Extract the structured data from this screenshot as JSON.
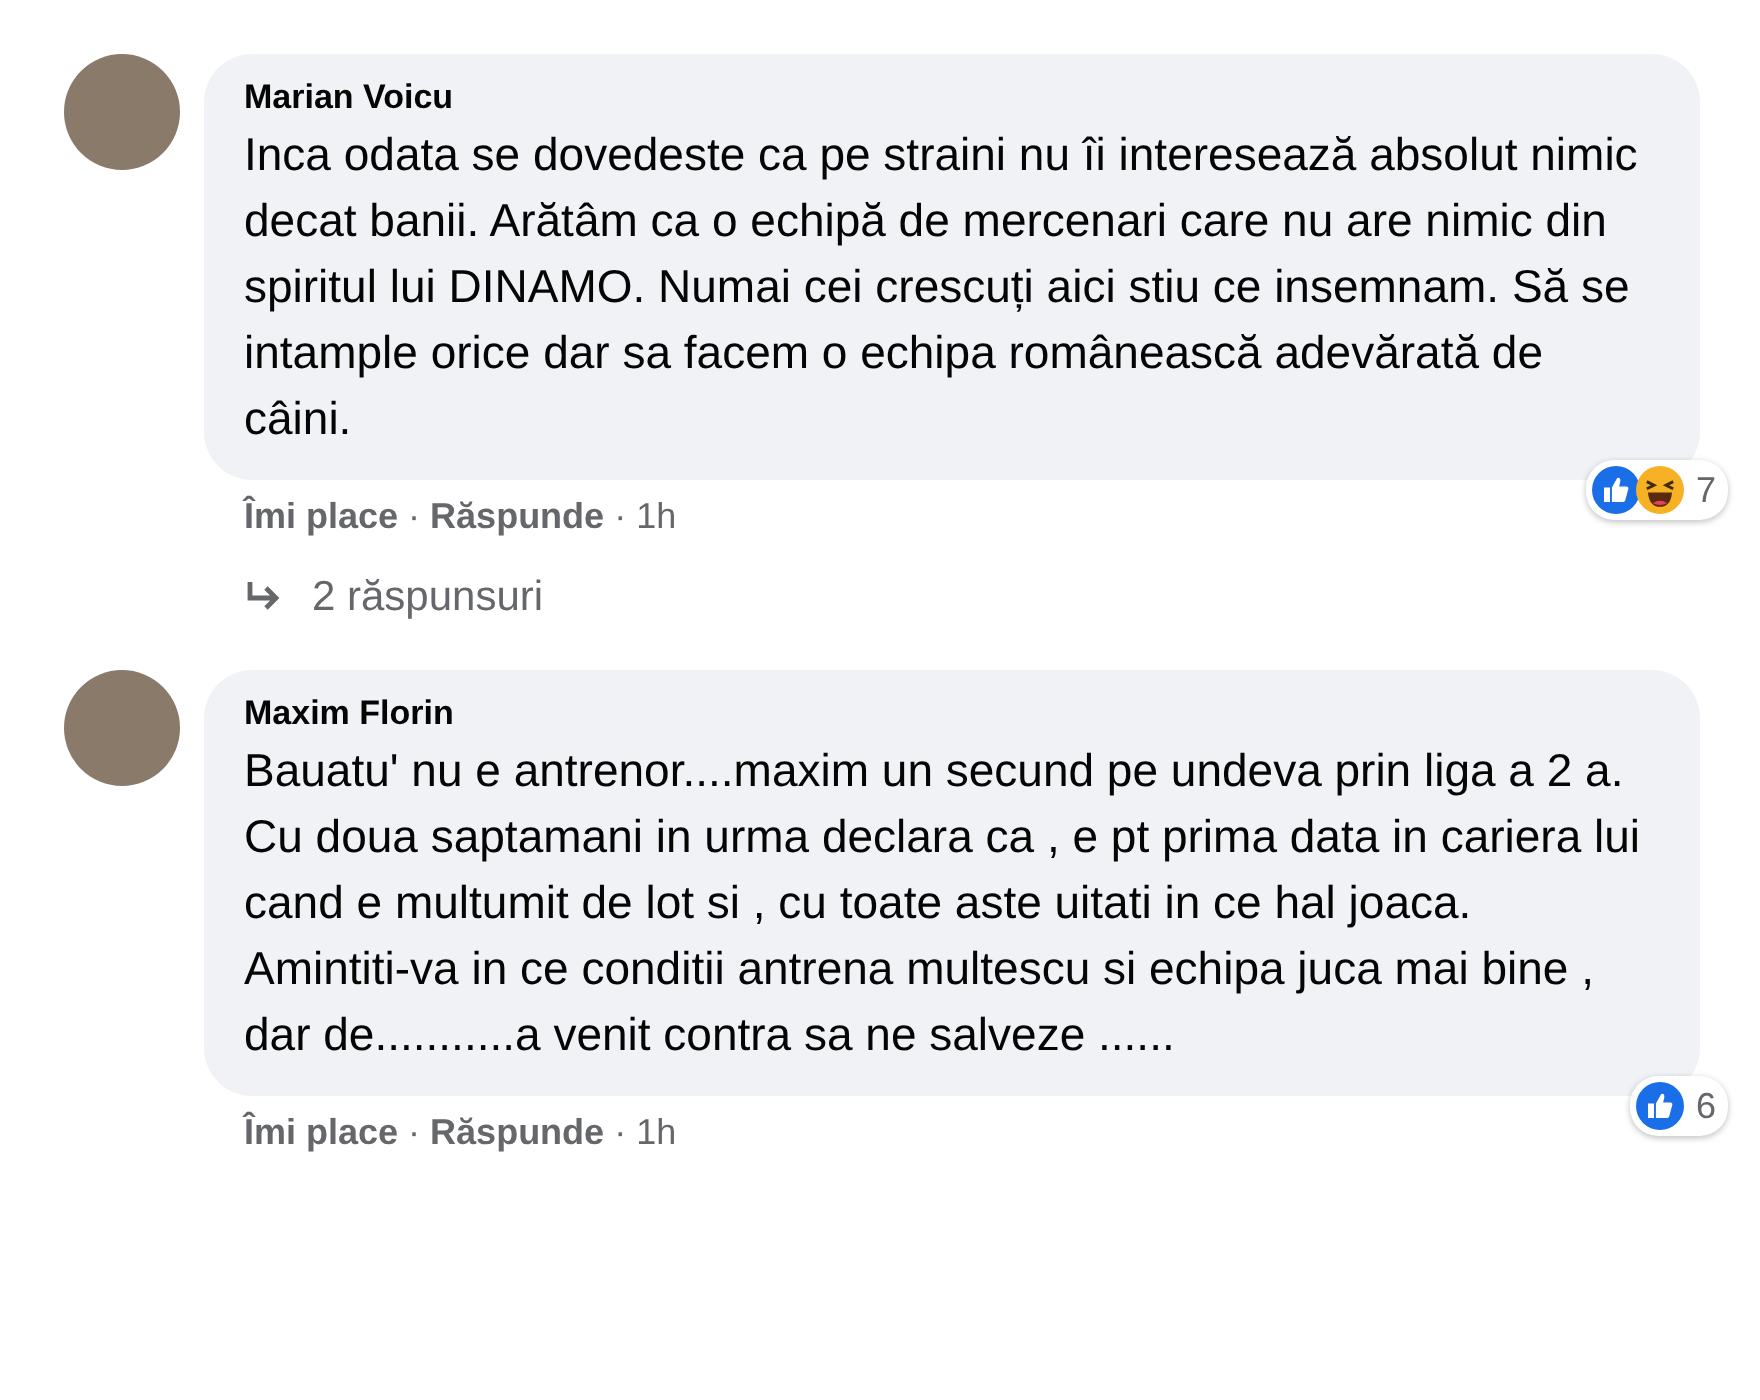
{
  "comments": [
    {
      "author": "Marian Voicu",
      "text": "Inca odata se dovedeste ca pe straini nu îi interesează absolut nimic decat banii. Arătâm ca o echipă de mercenari care nu are nimic din spiritul lui DINAMO. Numai cei crescuți aici stiu ce insemnam. Să se intample orice dar sa facem o echipa românească adevărată de câini.",
      "reactions": [
        {
          "kind": "like"
        },
        {
          "kind": "haha"
        }
      ],
      "reaction_count": "7",
      "actions": [
        {
          "label": "Îmi place"
        },
        {
          "label": "Răspunde"
        }
      ],
      "separator": "·",
      "time": "1h",
      "replies": "2 răspunsuri"
    },
    {
      "author": "Maxim Florin",
      "text": "Bauatu' nu e antrenor....maxim un secund pe undeva prin liga a 2 a. Cu doua saptamani in urma declara ca , e pt prima data in cariera lui cand e multumit de lot si , cu toate aste uitati in ce hal joaca. Amintiti-va in ce conditii antrena multescu si echipa juca mai bine , dar de...........a venit contra sa ne salveze ......",
      "reactions": [
        {
          "kind": "like"
        }
      ],
      "reaction_count": "6",
      "actions": [
        {
          "label": "Îmi place"
        },
        {
          "label": "Răspunde"
        }
      ],
      "separator": "·",
      "time": "1h"
    }
  ]
}
